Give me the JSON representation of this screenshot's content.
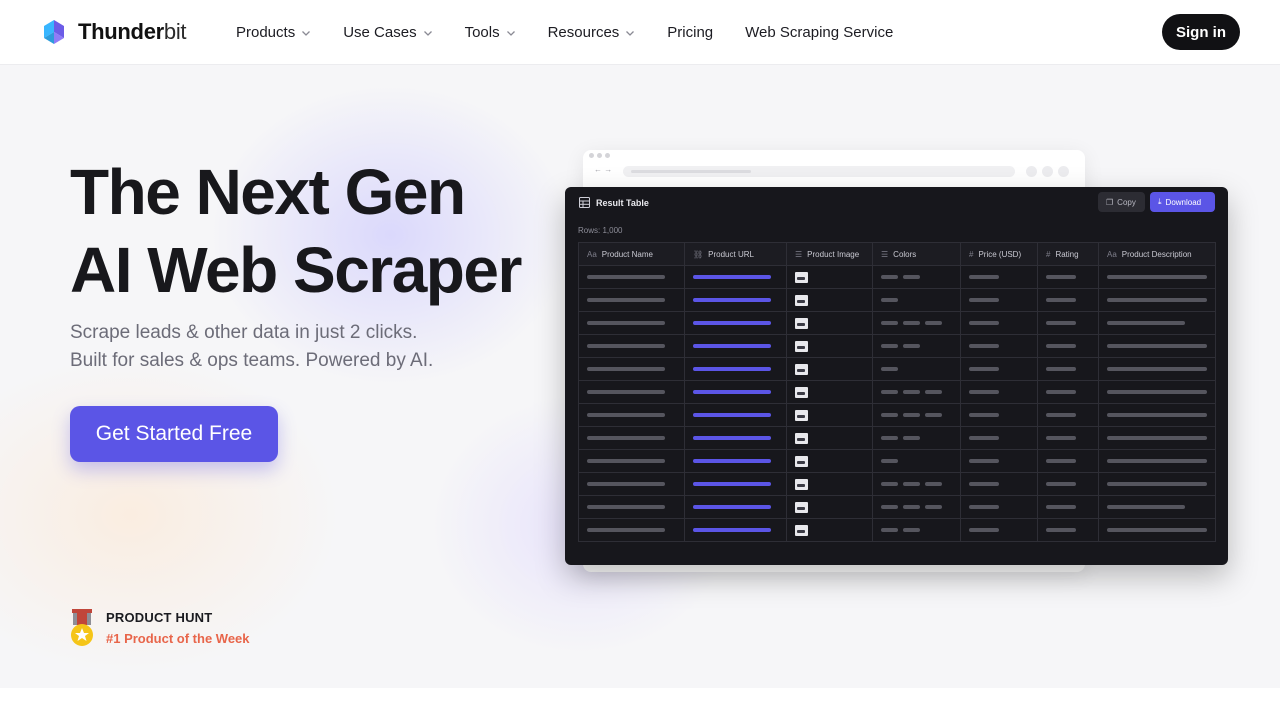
{
  "brand": {
    "name_bold": "Thunder",
    "name_light": "bit",
    "colors": {
      "accent": "#5b55e6",
      "dark": "#111114",
      "award": "#e8654a"
    }
  },
  "nav": {
    "items": [
      {
        "label": "Products",
        "dropdown": true
      },
      {
        "label": "Use Cases",
        "dropdown": true
      },
      {
        "label": "Tools",
        "dropdown": true
      },
      {
        "label": "Resources",
        "dropdown": true
      },
      {
        "label": "Pricing",
        "dropdown": false
      },
      {
        "label": "Web Scraping Service",
        "dropdown": false
      }
    ],
    "signin_label": "Sign in"
  },
  "hero": {
    "headline_line1": "The Next Gen",
    "headline_line2": "AI Web Scraper",
    "sub_line1": "Scrape leads & other data in just 2 clicks.",
    "sub_line2": "Built for sales & ops teams. Powered by AI.",
    "cta_label": "Get Started Free"
  },
  "award": {
    "title": "PRODUCT HUNT",
    "subtitle": "#1 Product of the Week"
  },
  "result_table": {
    "title": "Result Table",
    "copy_label": "Copy",
    "download_label": "Download",
    "rows_label": "Rows: 1,000",
    "columns": [
      {
        "label": "Product Name",
        "icon": "text-type-icon",
        "glyph": "Aa"
      },
      {
        "label": "Product URL",
        "icon": "link-icon",
        "glyph": "⛓"
      },
      {
        "label": "Product Image",
        "icon": "list-icon",
        "glyph": "☰"
      },
      {
        "label": "Colors",
        "icon": "list-icon",
        "glyph": "☰"
      },
      {
        "label": "Price (USD)",
        "icon": "hash-icon",
        "glyph": "#"
      },
      {
        "label": "Rating",
        "icon": "hash-icon",
        "glyph": "#"
      },
      {
        "label": "Product Description",
        "icon": "text-type-icon",
        "glyph": "Aa"
      }
    ],
    "color_swatch_counts": [
      2,
      1,
      3,
      2,
      1,
      3,
      3,
      2,
      1,
      3,
      3,
      2
    ]
  }
}
